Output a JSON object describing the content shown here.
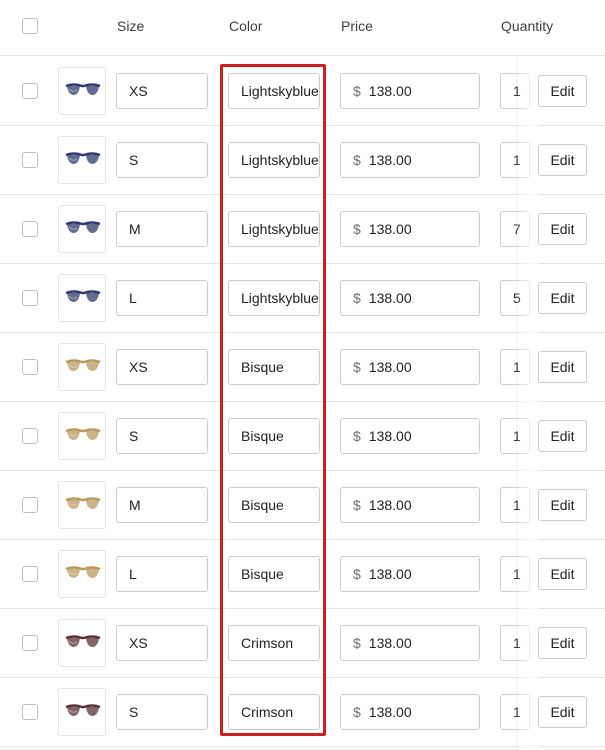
{
  "header": {
    "size_label": "Size",
    "color_label": "Color",
    "price_label": "Price",
    "quantity_label": "Quantity"
  },
  "currency_symbol": "$",
  "edit_label": "Edit",
  "variants": [
    {
      "size": "XS",
      "color": "Lightskyblue",
      "price": "138.00",
      "quantity": "1",
      "frame_color": "#2d3a6b"
    },
    {
      "size": "S",
      "color": "Lightskyblue",
      "price": "138.00",
      "quantity": "1",
      "frame_color": "#2d3a6b"
    },
    {
      "size": "M",
      "color": "Lightskyblue",
      "price": "138.00",
      "quantity": "7",
      "frame_color": "#2d3a6b"
    },
    {
      "size": "L",
      "color": "Lightskyblue",
      "price": "138.00",
      "quantity": "5",
      "frame_color": "#2d3a6b"
    },
    {
      "size": "XS",
      "color": "Bisque",
      "price": "138.00",
      "quantity": "1",
      "frame_color": "#b89a5e"
    },
    {
      "size": "S",
      "color": "Bisque",
      "price": "138.00",
      "quantity": "1",
      "frame_color": "#b89a5e"
    },
    {
      "size": "M",
      "color": "Bisque",
      "price": "138.00",
      "quantity": "1",
      "frame_color": "#b89a5e"
    },
    {
      "size": "L",
      "color": "Bisque",
      "price": "138.00",
      "quantity": "1",
      "frame_color": "#b89a5e"
    },
    {
      "size": "XS",
      "color": "Crimson",
      "price": "138.00",
      "quantity": "1",
      "frame_color": "#5a3236"
    },
    {
      "size": "S",
      "color": "Crimson",
      "price": "138.00",
      "quantity": "1",
      "frame_color": "#5a3236"
    }
  ],
  "highlight_color": "#cc1f1f"
}
